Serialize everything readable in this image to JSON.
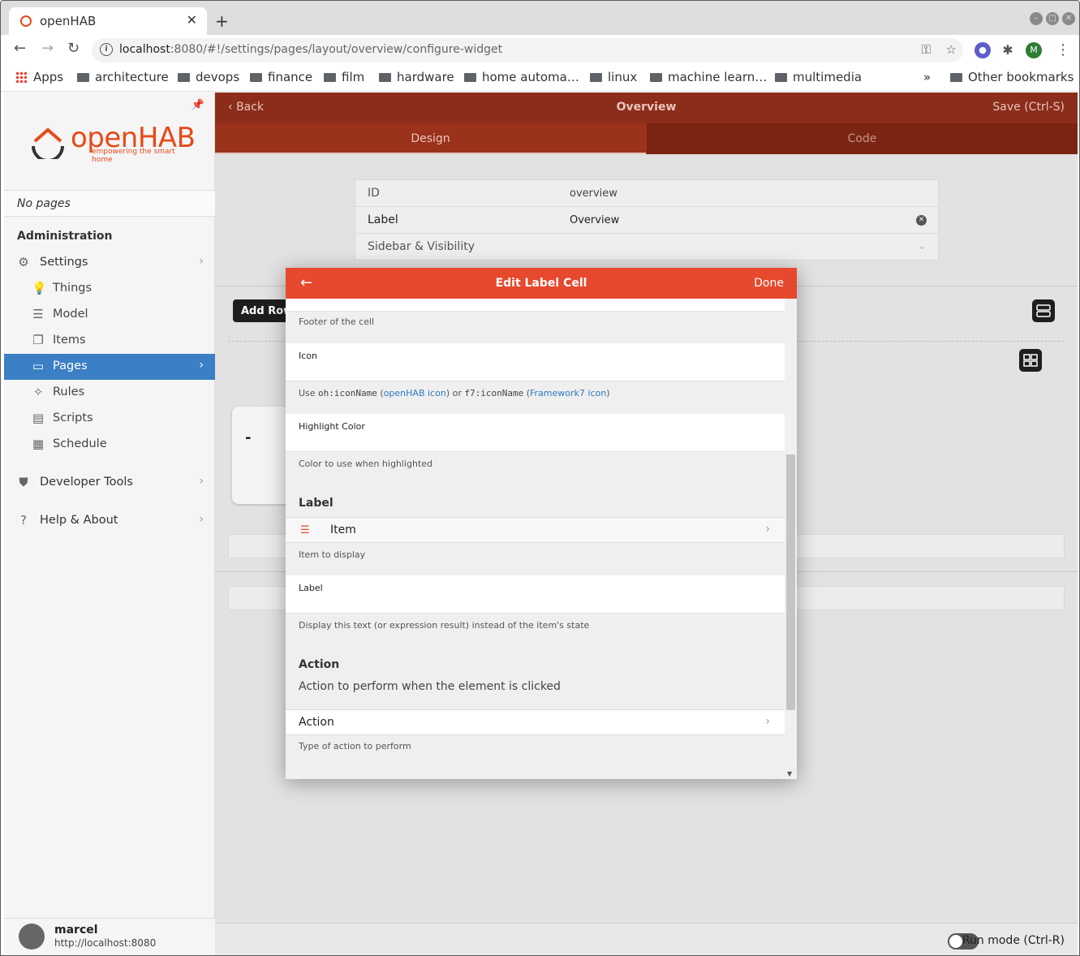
{
  "browser": {
    "tab_title": "openHAB",
    "url_host": "localhost",
    "url_rest": ":8080/#!/settings/pages/layout/overview/configure-widget",
    "profile_initial": "M",
    "bookmarks": [
      "Apps",
      "architecture",
      "devops",
      "finance",
      "film",
      "hardware",
      "home automa…",
      "linux",
      "machine learn…",
      "multimedia"
    ],
    "bookmarks_more": "»",
    "other_bookmarks": "Other bookmarks"
  },
  "sidebar": {
    "logo_text": "openHAB",
    "logo_tagline": "empowering the smart home",
    "no_pages": "No pages",
    "admin_heading": "Administration",
    "items": [
      {
        "label": "Settings",
        "icon": "gear-icon"
      },
      {
        "label": "Things",
        "icon": "lightbulb-icon"
      },
      {
        "label": "Model",
        "icon": "list-icon"
      },
      {
        "label": "Items",
        "icon": "square-stack-icon"
      },
      {
        "label": "Pages",
        "icon": "display-icon"
      },
      {
        "label": "Rules",
        "icon": "wand-icon"
      },
      {
        "label": "Scripts",
        "icon": "document-icon"
      },
      {
        "label": "Schedule",
        "icon": "calendar-icon"
      },
      {
        "label": "Developer Tools",
        "icon": "shield-icon"
      },
      {
        "label": "Help & About",
        "icon": "question-icon"
      }
    ],
    "user_name": "marcel",
    "user_host": "http://localhost:8080"
  },
  "page": {
    "back_label": "Back",
    "title": "Overview",
    "save_label": "Save (Ctrl-S)",
    "tab_design": "Design",
    "tab_code": "Code",
    "form": {
      "id_key": "ID",
      "id_value": "overview",
      "label_key": "Label",
      "label_value": "Overview",
      "sidebar_key": "Sidebar & Visibility"
    },
    "add_row": "Add Row",
    "card_value": "-",
    "run_mode": "Run mode (Ctrl-R)"
  },
  "modal": {
    "title": "Edit Label Cell",
    "done": "Done",
    "footer_hint": "Footer of the cell",
    "icon_label": "Icon",
    "icon_hint_pre": "Use ",
    "icon_hint_code1": "oh:iconName",
    "icon_hint_link1": "openHAB icon",
    "icon_hint_mid": ") or ",
    "icon_hint_code2": "f7:iconName",
    "icon_hint_link2": "Framework7 icon",
    "highlight_label": "Highlight Color",
    "highlight_hint": "Color to use when highlighted",
    "section_label": "Label",
    "item_row": "Item",
    "item_hint": "Item to display",
    "label_field": "Label",
    "label_hint": "Display this text (or expression result) instead of the item's state",
    "section_action": "Action",
    "action_desc": "Action to perform when the element is clicked",
    "action_row": "Action",
    "action_hint": "Type of action to perform"
  },
  "colors": {
    "navbar": "#8b2d1a",
    "modal_header": "#e6492d",
    "active_nav": "#3b7fc4",
    "link": "#2a7ac6"
  }
}
